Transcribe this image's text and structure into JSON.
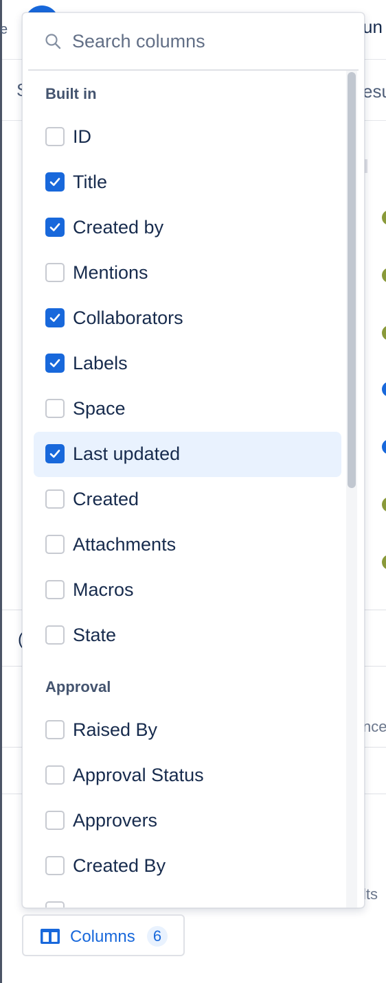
{
  "background": {
    "header_right_text": "un",
    "header_left_text": "e",
    "toolbar_left_text": "S",
    "toolbar_right_text": "esu",
    "side_text_1": "nce",
    "side_text_2": "lts",
    "left_glyph": "("
  },
  "dropdown": {
    "search": {
      "placeholder": "Search columns",
      "value": ""
    },
    "sections": [
      {
        "heading": "Built in",
        "items": [
          {
            "label": "ID",
            "checked": false
          },
          {
            "label": "Title",
            "checked": true
          },
          {
            "label": "Created by",
            "checked": true
          },
          {
            "label": "Mentions",
            "checked": false
          },
          {
            "label": "Collaborators",
            "checked": true
          },
          {
            "label": "Labels",
            "checked": true
          },
          {
            "label": "Space",
            "checked": false
          },
          {
            "label": "Last updated",
            "checked": true,
            "highlighted": true
          },
          {
            "label": "Created",
            "checked": false
          },
          {
            "label": "Attachments",
            "checked": false
          },
          {
            "label": "Macros",
            "checked": false
          },
          {
            "label": "State",
            "checked": false
          }
        ]
      },
      {
        "heading": "Approval",
        "items": [
          {
            "label": "Raised By",
            "checked": false
          },
          {
            "label": "Approval Status",
            "checked": false
          },
          {
            "label": "Approvers",
            "checked": false
          },
          {
            "label": "Created By",
            "checked": false
          }
        ]
      }
    ]
  },
  "columns_button": {
    "label": "Columns",
    "count": "6",
    "icon": "columns-icon"
  },
  "colors": {
    "accent": "#1868db",
    "highlight": "#e9f2fe",
    "text": "#172b4d",
    "heading": "#44546f",
    "border": "#dfe1e6"
  }
}
